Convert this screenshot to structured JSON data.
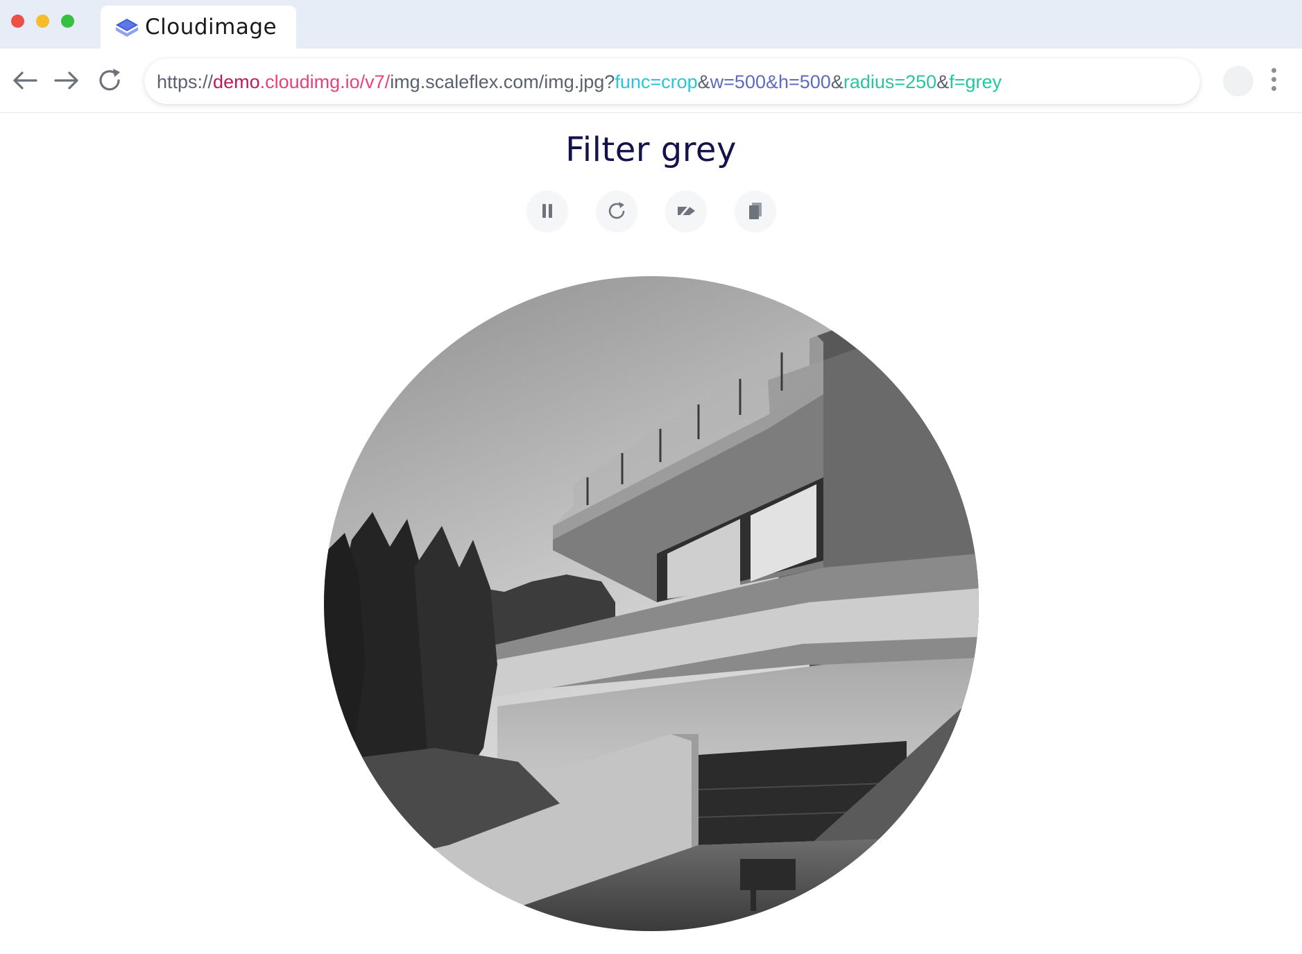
{
  "browser": {
    "tab": {
      "title": "Cloudimage",
      "icon": "cloudimage-logo-icon"
    },
    "url": {
      "protocol": "https://",
      "subdomain": "demo",
      "host_path": ".cloudimg.io/v7/",
      "origin_path": "img.scaleflex.com/img.jpg?",
      "func": "func=crop",
      "amp1": "&",
      "dims": "w=500&h=500",
      "amp2": "&",
      "radius": "radius=250",
      "amp3": "&",
      "filter": "f=grey"
    },
    "colors": {
      "subdomain": "#c2185b",
      "host": "#ec407a",
      "func": "#26c6da",
      "dims": "#5c6bc0",
      "radius": "#26c6a0",
      "filter": "#1ec8a0"
    }
  },
  "page": {
    "title": "Filter grey",
    "controls": [
      {
        "icon": "pause-icon"
      },
      {
        "icon": "reload-icon"
      },
      {
        "icon": "tag-icon"
      },
      {
        "icon": "copy-icon"
      }
    ],
    "image": {
      "subject": "modern-house-greyscale-photo",
      "shape": "circle"
    }
  }
}
